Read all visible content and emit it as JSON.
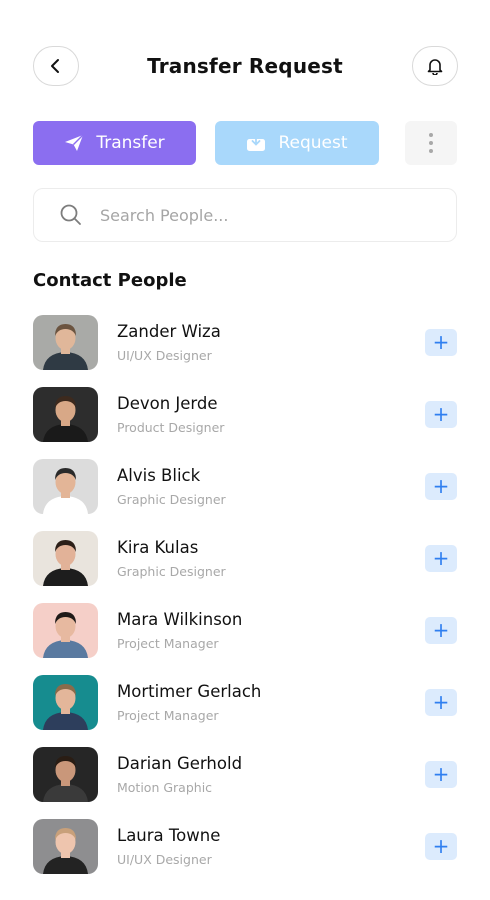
{
  "header": {
    "title": "Transfer Request",
    "back_icon": "chevron-left-icon",
    "bell_icon": "bell-icon"
  },
  "actions": {
    "transfer_label": "Transfer",
    "request_label": "Request",
    "transfer_color": "#8b6ef0",
    "request_color": "#a9d8fb"
  },
  "search": {
    "placeholder": "Search People...",
    "value": ""
  },
  "section_title": "Contact People",
  "contacts": [
    {
      "name": "Zander Wiza",
      "role": "UI/UX Designer",
      "bg": "#a9aaa7",
      "shirt": "#2f3a44",
      "hair": "#6b5440",
      "skin": "#e0b79a"
    },
    {
      "name": "Devon Jerde",
      "role": "Product Designer",
      "bg": "#2d2d2d",
      "shirt": "#1a1a1a",
      "hair": "#3d2a1e",
      "skin": "#d8a887"
    },
    {
      "name": "Alvis Blick",
      "role": "Graphic Designer",
      "bg": "#dcdcdc",
      "shirt": "#ffffff",
      "hair": "#2a2a2a",
      "skin": "#e3b597"
    },
    {
      "name": "Kira Kulas",
      "role": "Graphic Designer",
      "bg": "#e9e4dd",
      "shirt": "#1d1d1d",
      "hair": "#2c1f18",
      "skin": "#e2b298"
    },
    {
      "name": "Mara Wilkinson",
      "role": "Project Manager",
      "bg": "#f5cfc8",
      "shirt": "#5a7aa0",
      "hair": "#1f1a18",
      "skin": "#e7b9a0"
    },
    {
      "name": "Mortimer Gerlach",
      "role": "Project Manager",
      "bg": "#168c8f",
      "shirt": "#2d3e5c",
      "hair": "#8a6b4a",
      "skin": "#e3b69a"
    },
    {
      "name": "Darian Gerhold",
      "role": "Motion Graphic",
      "bg": "#262626",
      "shirt": "#3a3a3a",
      "hair": "#2a1d14",
      "skin": "#c9977a"
    },
    {
      "name": "Laura Towne",
      "role": "UI/UX Designer",
      "bg": "#8e8e90",
      "shirt": "#232323",
      "hair": "#c8a07a",
      "skin": "#eec5ae"
    }
  ]
}
